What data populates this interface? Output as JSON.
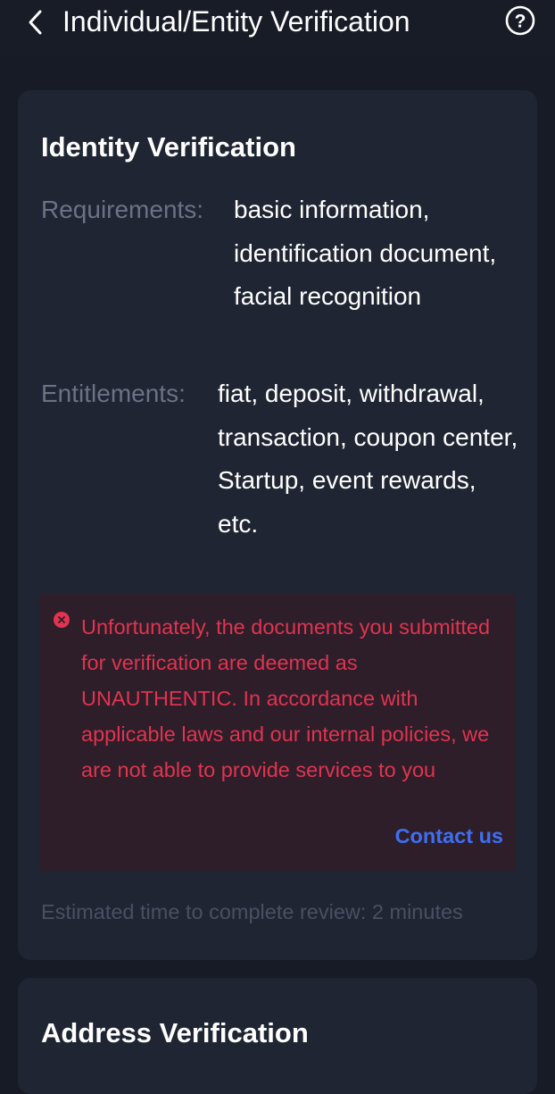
{
  "header": {
    "title": "Individual/Entity Verification",
    "back_icon": "chevron-left-icon",
    "help_icon": "question-circle-icon",
    "help_glyph": "?"
  },
  "identity": {
    "title": "Identity Verification",
    "requirements_label": "Requirements:",
    "requirements_value": "basic information, identification document, facial recognition",
    "entitlements_label": "Entitlements:",
    "entitlements_value": "fiat, deposit, withdrawal, transaction, coupon center, Startup, event rewards, etc.",
    "error": {
      "message": "Unfortunately, the documents you submitted for verification are deemed as UNAUTHENTIC. In accordance with applicable laws and our internal policies, we are not able to provide services to you",
      "contact_label": "Contact us",
      "icon": "error-circle-icon"
    },
    "estimate": "Estimated time to complete review: 2 minutes"
  },
  "address": {
    "title": "Address Verification"
  },
  "colors": {
    "background": "#161b26",
    "card": "#1f2532",
    "error_text": "#e0344f",
    "error_bg": "#2d1e2a",
    "link": "#3f6ff0",
    "label": "#6b7285"
  }
}
